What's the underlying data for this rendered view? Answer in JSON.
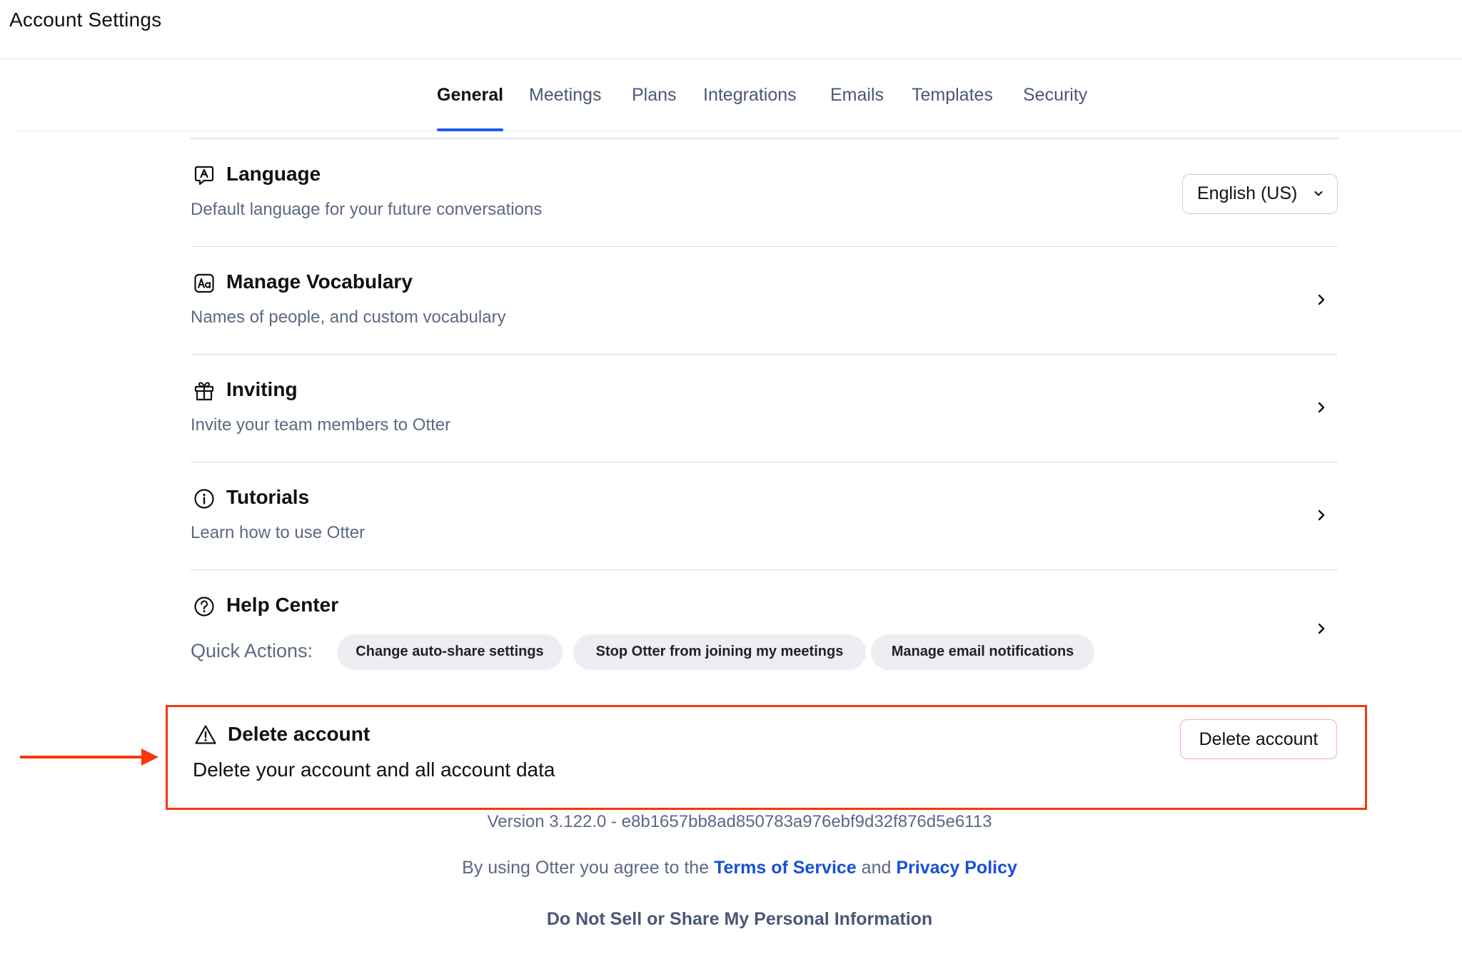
{
  "page": {
    "title": "Account Settings"
  },
  "tabs": [
    {
      "label": "General",
      "active": true
    },
    {
      "label": "Meetings",
      "active": false
    },
    {
      "label": "Plans",
      "active": false
    },
    {
      "label": "Integrations",
      "active": false
    },
    {
      "label": "Emails",
      "active": false
    },
    {
      "label": "Templates",
      "active": false
    },
    {
      "label": "Security",
      "active": false
    }
  ],
  "settings": {
    "language": {
      "title": "Language",
      "description": "Default language for your future conversations",
      "selected": "English (US)",
      "icon": "language-icon"
    },
    "vocabulary": {
      "title": "Manage Vocabulary",
      "description": "Names of people, and custom vocabulary",
      "icon": "vocabulary-icon"
    },
    "inviting": {
      "title": "Inviting",
      "description": "Invite your team members to Otter",
      "icon": "gift-icon"
    },
    "tutorials": {
      "title": "Tutorials",
      "description": "Learn how to use Otter",
      "icon": "info-icon"
    },
    "help": {
      "title": "Help Center",
      "quick_actions_label": "Quick Actions:",
      "icon": "help-icon",
      "quick_actions": [
        "Change auto-share settings",
        "Stop Otter from joining my meetings",
        "Manage email notifications"
      ]
    },
    "delete": {
      "title": "Delete account",
      "description": "Delete your account and all account data",
      "button_label": "Delete account",
      "icon": "warning-icon"
    }
  },
  "footer": {
    "version": "Version 3.122.0 - e8b1657bb8ad850783a976ebf9d32f876d5e6113",
    "agree_prefix": "By using Otter you agree to the",
    "terms_link": "Terms of Service",
    "agree_and": "and",
    "privacy_link": "Privacy Policy",
    "do_not_sell": "Do Not Sell or Share My Personal Information"
  },
  "colors": {
    "accent": "#1a5bf2",
    "highlight": "#f4380f",
    "link": "#1a4fd8",
    "muted_text": "#5c6883"
  }
}
